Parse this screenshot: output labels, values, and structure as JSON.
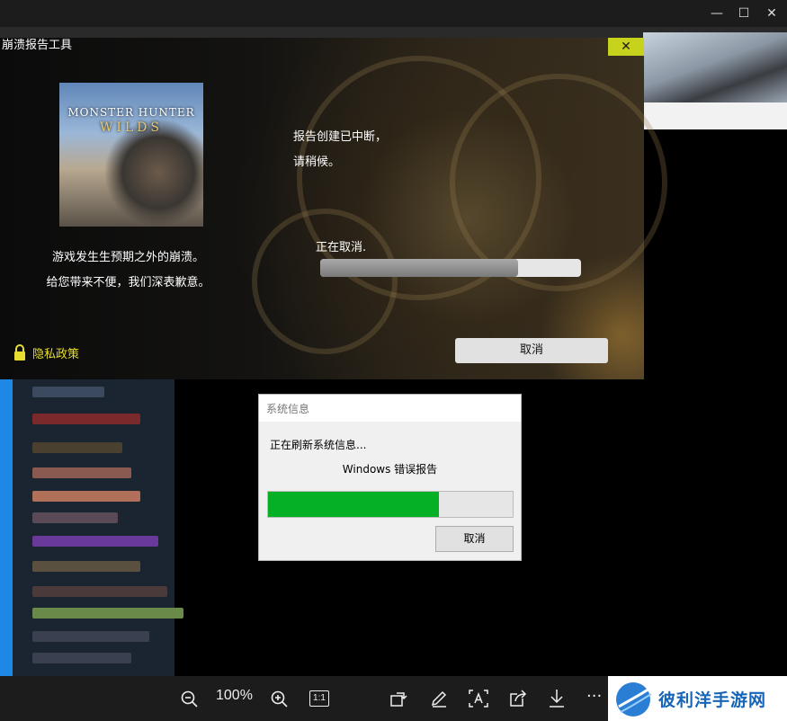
{
  "viewer": {
    "window_controls": {
      "minimize": "—",
      "maximize": "☐",
      "close": "✕"
    },
    "toolbar": {
      "zoom_level": "100%",
      "actual_size_label": "1:1",
      "more_label": "···"
    }
  },
  "crash_reporter": {
    "title": "崩溃报告工具",
    "close_label": "✕",
    "game_cover": {
      "logo_line1": "MONSTER HUNTER",
      "logo_line2": "WILDS"
    },
    "apology_line1": "游戏发生生预期之外的崩溃。",
    "apology_line2": "给您带来不便，我们深表歉意。",
    "status_line1": "报告创建已中断，",
    "status_line2": "请稍候。",
    "progress_label": "正在取消.",
    "progress_percent": 76,
    "privacy_label": "隐私政策",
    "cancel_label": "取消",
    "accent_color": "#c7d21c"
  },
  "system_info_dialog": {
    "title": "系统信息",
    "line1": "正在刷新系统信息...",
    "line2": "Windows 错误报告",
    "progress_percent": 70,
    "progress_color": "#06b025",
    "cancel_label": "取消"
  },
  "watermark": {
    "text": "彼利洋手游网"
  }
}
